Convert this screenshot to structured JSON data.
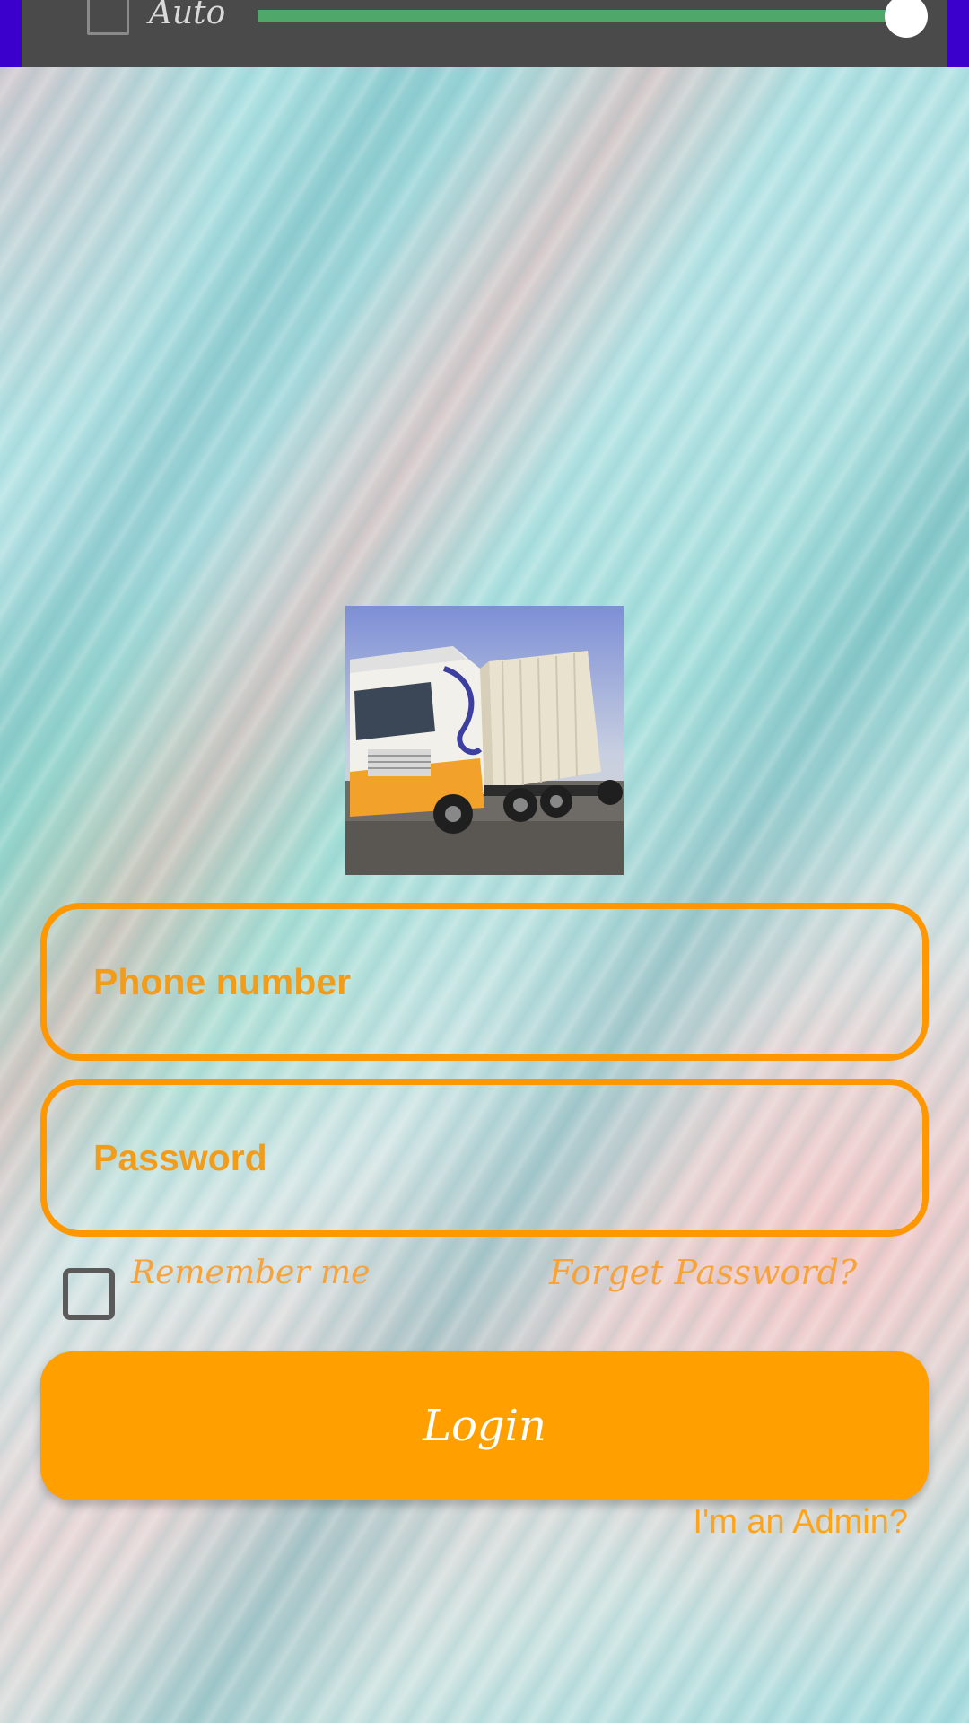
{
  "top_bar": {
    "auto_label": "Auto",
    "slider_level": 1.0
  },
  "image": {
    "subject": "truck-with-container"
  },
  "form": {
    "phone_placeholder": "Phone number",
    "password_placeholder": "Password",
    "remember_label": "Remember me",
    "forget_label": "Forget Password?",
    "login_label": "Login",
    "admin_label": "I'm an Admin?"
  },
  "colors": {
    "accent": "#ff9f00",
    "top_bar": "#4a4a4a",
    "slider_track": "#4fa86a",
    "edge": "#3b00cc"
  }
}
